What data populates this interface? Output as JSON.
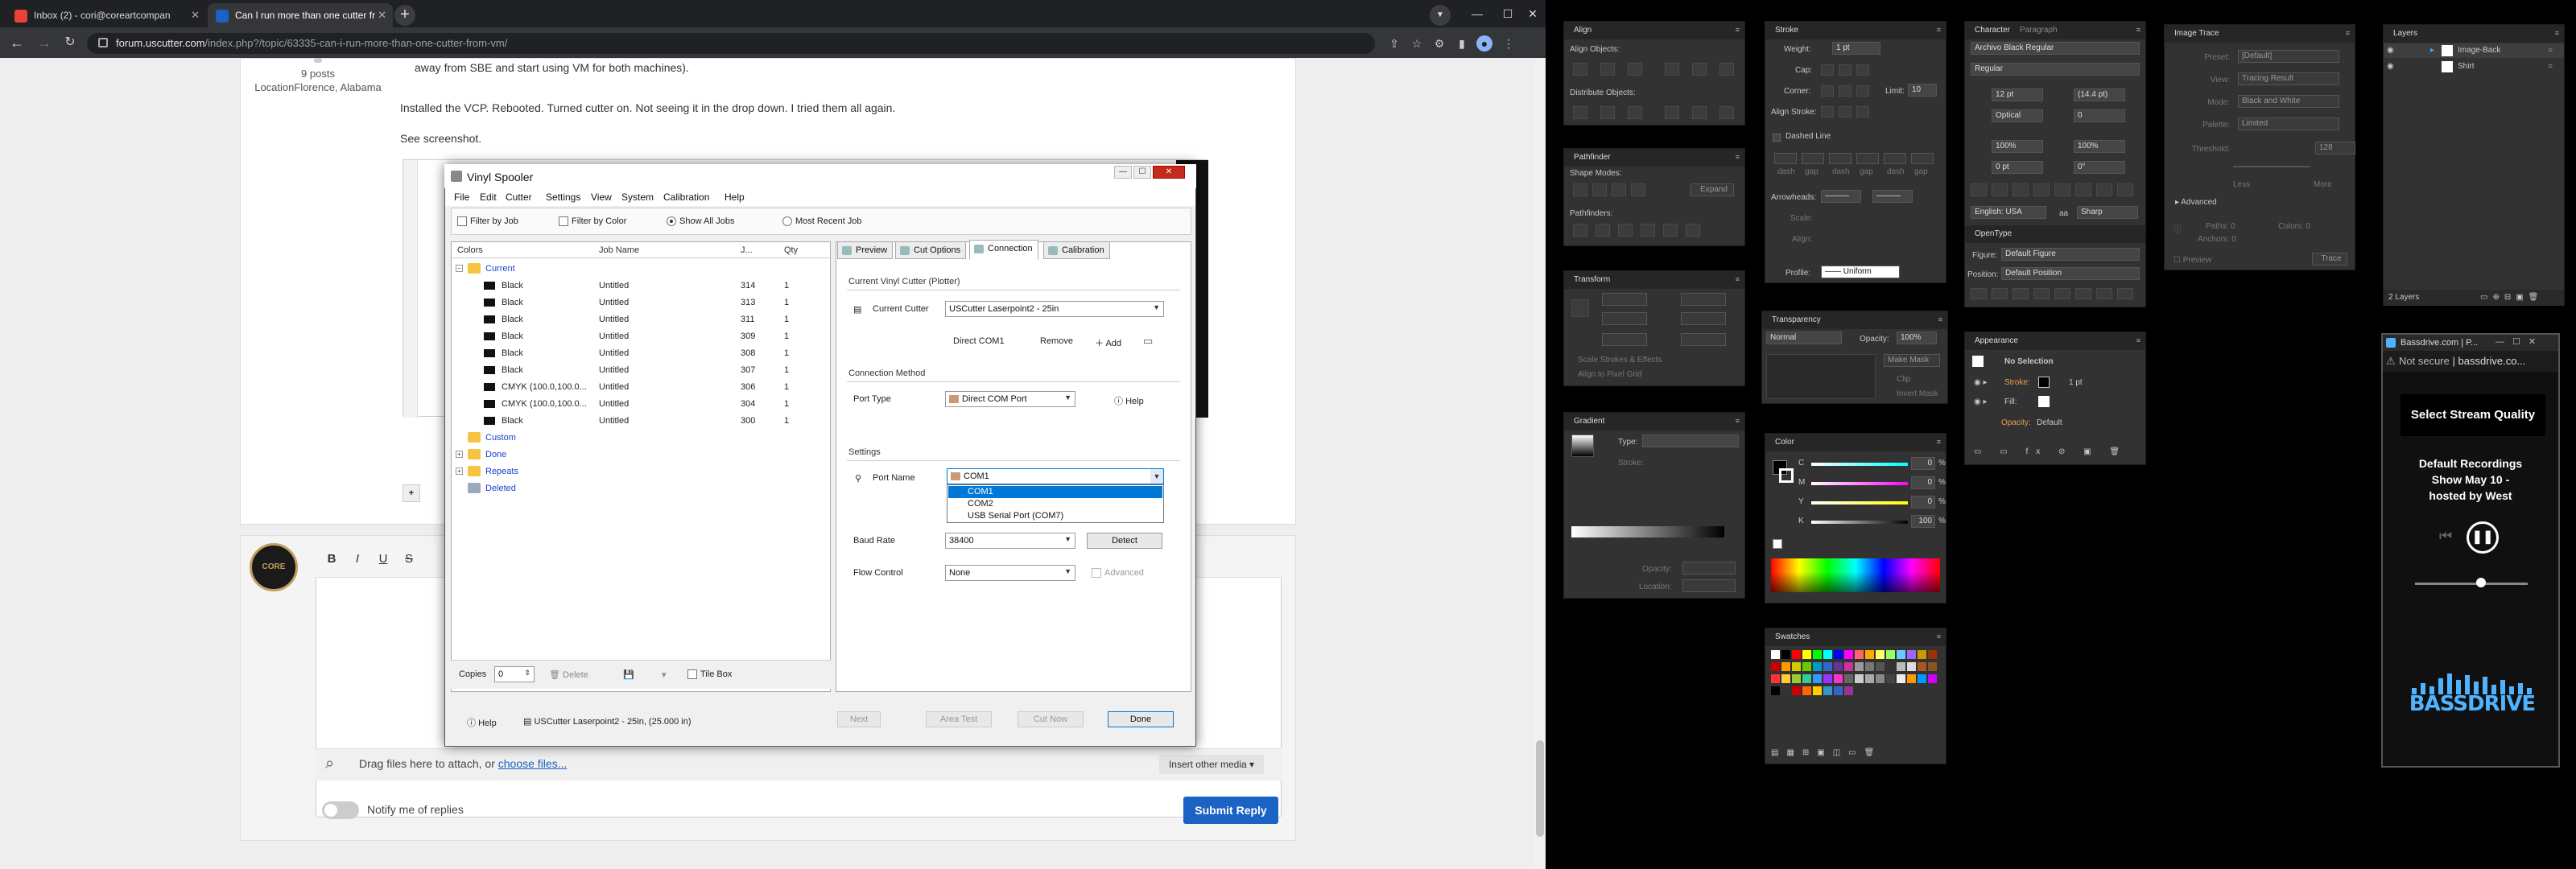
{
  "browser": {
    "tabs": [
      {
        "title": "Inbox (2) - cori@coreartcompan",
        "favicon_color": "#ea4335"
      },
      {
        "title": "Can I run more than one cutter fr",
        "favicon_color": "#1a62c4"
      }
    ],
    "new_tab": "+",
    "url_domain": "forum.uscutter.com",
    "url_path": "/index.php?/topic/63335-can-i-run-more-than-one-cutter-from-vm/"
  },
  "forum": {
    "user_posts": "9 posts",
    "user_location": "LocationFlorence, Alabama",
    "line0": "away from SBE and start using VM for both machines).",
    "line1": "Installed the VCP. Rebooted. Turned cutter on. Not seeing it in the drop down. I tried them all again.",
    "line2": "See screenshot.",
    "editor_buttons": [
      "B",
      "I",
      "U",
      "S"
    ],
    "attach_text": "Drag files here to attach, or ",
    "attach_link": "choose files...",
    "insert_media": "Insert other media ▾",
    "notify": "Notify me of replies",
    "submit": "Submit Reply"
  },
  "spooler": {
    "title": "Vinyl Spooler",
    "menu": [
      "File",
      "Edit",
      "Cutter",
      "Settings",
      "View",
      "System",
      "Calibration",
      "Help"
    ],
    "filters": {
      "filter_by_job": "Filter by Job",
      "filter_by_color": "Filter by Color",
      "show_all": "Show All Jobs",
      "most_recent": "Most Recent Job"
    },
    "columns": {
      "colors": "Colors",
      "job_name": "Job Name",
      "num": "J...",
      "qty": "Qty"
    },
    "folders": {
      "current": "Current",
      "custom": "Custom",
      "done": "Done",
      "repeats": "Repeats",
      "deleted": "Deleted"
    },
    "jobs": [
      {
        "color": "Black",
        "name": "Untitled",
        "num": "314",
        "qty": "1"
      },
      {
        "color": "Black",
        "name": "Untitled",
        "num": "313",
        "qty": "1"
      },
      {
        "color": "Black",
        "name": "Untitled",
        "num": "311",
        "qty": "1"
      },
      {
        "color": "Black",
        "name": "Untitled",
        "num": "309",
        "qty": "1"
      },
      {
        "color": "Black",
        "name": "Untitled",
        "num": "308",
        "qty": "1"
      },
      {
        "color": "Black",
        "name": "Untitled",
        "num": "307",
        "qty": "1"
      },
      {
        "color": "CMYK (100.0,100.0...",
        "name": "Untitled",
        "num": "306",
        "qty": "1"
      },
      {
        "color": "CMYK (100.0,100.0...",
        "name": "Untitled",
        "num": "304",
        "qty": "1"
      },
      {
        "color": "Black",
        "name": "Untitled",
        "num": "300",
        "qty": "1"
      }
    ],
    "tabs": [
      "Preview",
      "Cut Options",
      "Connection",
      "Calibration"
    ],
    "current_cutter_group": "Current Vinyl Cutter (Plotter)",
    "current_cutter_label": "Current Cutter",
    "current_cutter_value": "USCutter Laserpoint2 - 25in",
    "direct_com": "Direct COM1",
    "remove": "Remove",
    "add": "Add",
    "connection_method": "Connection Method",
    "port_type_label": "Port Type",
    "port_type_value": "Direct COM Port",
    "help": "Help",
    "settings_group": "Settings",
    "port_name_label": "Port Name",
    "port_name_value": "COM1",
    "port_options": [
      "COM1",
      "COM2",
      "USB Serial Port (COM7)"
    ],
    "baud_label": "Baud Rate",
    "baud_value": "38400",
    "detect": "Detect",
    "flow_label": "Flow Control",
    "flow_value": "None",
    "advanced": "Advanced",
    "copies_label": "Copies",
    "copies_value": "0",
    "delete": "Delete",
    "tile_box": "Tile Box",
    "status_help": "Help",
    "status_cutter": "USCutter Laserpoint2 - 25in, (25.000 in)",
    "next": "Next",
    "area_test": "Area Test",
    "cut_now": "Cut Now",
    "done": "Done"
  },
  "ai": {
    "align": {
      "title": "Align",
      "align_objects": "Align Objects:",
      "distribute_objects": "Distribute Objects:"
    },
    "pathfinder": {
      "title": "Pathfinder",
      "shape_modes": "Shape Modes:",
      "pathfinders": "Pathfinders:",
      "expand": "Expand"
    },
    "transform": {
      "title": "Transform",
      "scale_strokes": "Scale Strokes & Effects",
      "align_pixel": "Align to Pixel Grid"
    },
    "gradient": {
      "title": "Gradient",
      "type": "Type:",
      "stroke": "Stroke:",
      "opacity": "Opacity:",
      "location": "Location:"
    },
    "stroke": {
      "title": "Stroke",
      "weight": "Weight:",
      "weight_value": "1 pt",
      "cap": "Cap:",
      "corner": "Corner:",
      "limit": "Limit:",
      "limit_value": "10",
      "align_stroke": "Align Stroke:",
      "dashed_line": "Dashed Line",
      "arrowheads": "Arrowheads:",
      "scale": "Scale:",
      "align": "Align:",
      "profile": "Profile:",
      "profile_value": "Uniform",
      "dash_labels": [
        "dash",
        "gap",
        "dash",
        "gap",
        "dash",
        "gap"
      ]
    },
    "transparency": {
      "title": "Transparency",
      "mode": "Normal",
      "opacity_label": "Opacity:",
      "opacity_value": "100%",
      "make_mask": "Make Mask",
      "clip": "Clip",
      "invert_mask": "Invert Mask"
    },
    "color": {
      "title": "Color",
      "channels": [
        "C",
        "M",
        "Y",
        "K"
      ],
      "values": [
        "0",
        "0",
        "0",
        "100"
      ]
    },
    "swatches": {
      "title": "Swatches"
    },
    "character": {
      "tab1": "Character",
      "tab2": "Paragraph",
      "font": "Archivo Black Regular",
      "style": "Regular",
      "size": "12 pt",
      "leading": "(14.4 pt)",
      "tracking_label": "Optical",
      "tracking": "0",
      "scale_v": "100%",
      "scale_h": "100%",
      "baseline": "0 pt",
      "rotation": "0°",
      "language": "English: USA",
      "aa": "Sharp",
      "aa_label": "aa"
    },
    "opentype": {
      "title": "OpenType",
      "figure_label": "Figure:",
      "figure": "Default Figure",
      "position_label": "Position:",
      "position": "Default Position"
    },
    "appearance": {
      "title": "Appearance",
      "selection": "No Selection",
      "stroke": "Stroke:",
      "stroke_value": "1 pt",
      "fill": "Fill:",
      "opacity": "Opacity:",
      "opacity_value": "Default"
    },
    "image_trace": {
      "title": "Image Trace",
      "preset": "Preset:",
      "preset_value": "[Default]",
      "view": "View:",
      "view_value": "Tracing Result",
      "mode": "Mode:",
      "mode_value": "Black and White",
      "palette": "Palette:",
      "palette_value": "Limited",
      "threshold": "Threshold:",
      "threshold_value": "128",
      "less": "Less",
      "more": "More",
      "advanced": "Advanced",
      "paths": "Paths:",
      "paths_value": "0",
      "colors": "Colors:",
      "colors_value": "0",
      "anchors": "Anchors:",
      "anchors_value": "0",
      "preview": "Preview",
      "trace": "Trace"
    },
    "layers": {
      "title": "Layers",
      "items": [
        "Image-Back",
        "Shirt"
      ],
      "count": "2 Layers"
    }
  },
  "bassdrive": {
    "title": "Bassdrive.com | P...",
    "not_secure": "Not secure",
    "domain": "bassdrive.co...",
    "select_stream": "Select Stream Quality",
    "line1": "Default Recordings",
    "line2": "Show May 10 -",
    "line3": "hosted by West",
    "logo": "BASSDRIVE"
  },
  "colors": {
    "accent": "#1a62c4",
    "ai_panel": "#323232",
    "highlight": "#0078d7"
  }
}
